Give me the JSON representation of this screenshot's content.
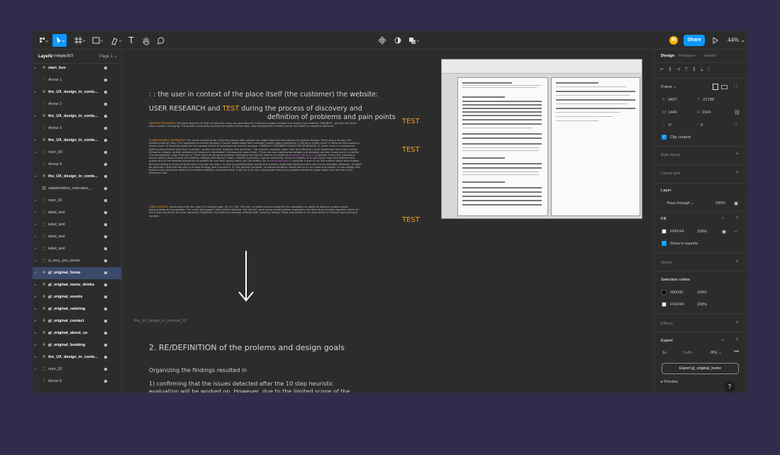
{
  "toolbar": {
    "avatar_initial": "M",
    "share_label": "Share",
    "zoom": "44%"
  },
  "left_panel": {
    "tab_layers": "Layers",
    "tab_assets": "Assets",
    "page_selector": "Page 1 ⌄",
    "layers": [
      {
        "name": "Rectangle 203",
        "icon": "rectangle"
      },
      {
        "name": "start_box",
        "icon": "frame"
      },
      {
        "name": "Arrow 1",
        "icon": "arrow"
      },
      {
        "name": "the_UX_design_in_conte...",
        "icon": "frame"
      },
      {
        "name": "Arrow 2",
        "icon": "arrow"
      },
      {
        "name": "the_UX_design_in_conte...",
        "icon": "frame"
      },
      {
        "name": "Arrow 3",
        "icon": "arrow"
      },
      {
        "name": "the_UX_design_in_conte...",
        "icon": "frame"
      },
      {
        "name": "num_00",
        "icon": "group"
      },
      {
        "name": "Arrow 4",
        "icon": "arrow"
      },
      {
        "name": "the_UX_design_in_conte...",
        "icon": "frame"
      },
      {
        "name": "stakeholders_interview_...",
        "icon": "image"
      },
      {
        "name": "num_01",
        "icon": "group"
      },
      {
        "name": "label_test",
        "icon": "group"
      },
      {
        "name": "label_test",
        "icon": "group"
      },
      {
        "name": "label_test",
        "icon": "group"
      },
      {
        "name": "label_test",
        "icon": "group"
      },
      {
        "name": "a_very_pro_arrow",
        "icon": "group"
      },
      {
        "name": "gl_original_home",
        "icon": "frame"
      },
      {
        "name": "gl_original_menu_drinks",
        "icon": "frame"
      },
      {
        "name": "gl_original_events",
        "icon": "frame"
      },
      {
        "name": "gl_original_catering",
        "icon": "frame"
      },
      {
        "name": "gl_original_contact",
        "icon": "frame"
      },
      {
        "name": "gl_original_about_us",
        "icon": "frame"
      },
      {
        "name": "gl_original_booking",
        "icon": "frame"
      },
      {
        "name": "the_UX_design_in_conte...",
        "icon": "frame"
      },
      {
        "name": "num_02",
        "icon": "group"
      },
      {
        "name": "Arrow 5",
        "icon": "arrow"
      }
    ]
  },
  "canvas": {
    "heading1": ": : the user in context of the place itself (the customer) the website:",
    "heading2_a": "USER RESEARCH and ",
    "heading2_test": "TEST",
    "heading2_b": " during the process of discovery and",
    "heading2_c": "definition of problems and pain points",
    "test_label": "TEST",
    "frame_label": "the_UX_design_in_context_02",
    "section_title": "2. RE/DEFINITION of the prolems and design goals",
    "organizing": "Organizing the findings resulted in",
    "confirm": "1) confirming that the issues detected after the 10 step heuristic evaluation will be worked on. However, due to the limited scope of the task, only the main page and the on-site menu page got redesigned;",
    "desktop_research_label": "DESKTOP RESEARCH",
    "desktop_research": ": the brief research to find out who the users are was done by checking Google reviews and Happy Cow website. FINDINGS : generic but there was a pattern emerging. The guests universally praised the quality of the food, cozy atmosphere, friendly owner and staff; no negative opinions.",
    "stakeholder_label": "STAKEHOLDER'S INTERVIEW",
    "stakeholder": ": The owner turned to be a friendly person with passion for vegan food and abundance of positive energy. There was a survey; the meeting took an hour. The questions and tasks focused 4 issues listed below with relevant (mostly open) questions: 1) What is Green Love? 2) Who are the guests in Green Love? 3) Business goals for the nearest future 4) greenlove.dk and its purpose. FINDINGS / DEFINING GOALS FOR REDESIGN: 1) Green Love is a restaurant offering plant based food that is healthy, locally sourced, made on the premises. The mission: promote vegan diet and lifestyle / raise awareness how food choices influence climate, animal wellbeing (if anyone is interested in finding out about that). There are also cooking workshops and standup comedy shows once in a while. The atmosphere: cosy, friendly. 2) There seem to be some patterns emerging that will be helpful to create an ",
    "persona1": "example persona 1",
    "stakeholder_b": ": a woman in her 40s, conscious about healthy food choices and healthy lifestyle (flexitarian/ vegan, climate conscious, regular exercising, focus on health). It is not known how tech efficient the guests are so the website should be accessible for non tech-savvy users, eg. the elderly. An ",
    "persona2": "example persona 2",
    "stakeholder_c": " could be a man in his 20s curious about plant based diet and willing to find out what there is to eat and learn. 3) Due to confidentiality issues the answers regarding business plans will not be revealed. However, it might be generally said that the aim is to keep finding new customers. 4) The general purpose: 'to attract whoever would like to try our food and values'. It was stated that testimonials should be added to increase credibility and build trust. It did not turn into a discussion about any problems that the page might have as that is the designer's job.",
    "card_sorting_label": "CARD SORTING",
    "card_sorting": ": performed with the help of 3 testers (age: 45, 47, 58). The aim: to detect how to organize the navigation to make all desired content easily discoverable and accessible. The cards with pages' titles (initial sitemap, but 'sliced') were given to each tester separately and then they decided together which of the 3 sets should be the final hierarchy. FINDINGS: the attached sitemap reflects their 'winning' design. What was added is my description of content and technical content."
  },
  "right_panel": {
    "tab_design": "Design",
    "tab_prototype": "Prototype",
    "tab_inspect": "Inspect",
    "frame_label": "Frame ⌄",
    "x_label": "X",
    "x_value": "-5497",
    "y_label": "Y",
    "y_value": "-21788",
    "w_label": "W",
    "w_value": "1440",
    "h_label": "H",
    "h_value": "2164",
    "rotation": "0°",
    "radius": "0",
    "clip_content": "Clip content",
    "auto_layout": "Auto layout",
    "layout_grid": "Layout grid",
    "layer_title": "Layer",
    "blend": "Pass through ⌄",
    "layer_opacity": "100%",
    "fill_title": "Fill",
    "fill_hex": "FFFFFF",
    "fill_opacity": "100%",
    "show_exports": "Show in exports",
    "stroke": "Stroke",
    "selection_colors": "Selection colors",
    "sel_color1": "000000",
    "sel_color1_opacity": "100%",
    "sel_color2": "FFFFFF",
    "sel_color2_opacity": "100%",
    "effects": "Effects",
    "export_title": "Export",
    "export_scale": "1x",
    "export_suffix": "Suffix",
    "export_format": "JPG ⌄",
    "export_button": "Export gl_original_home",
    "preview": "Preview",
    "help": "?"
  },
  "colors": {
    "accent": "#0d99ff",
    "highlight": "#f0a020",
    "background": "#2f2d4b"
  }
}
